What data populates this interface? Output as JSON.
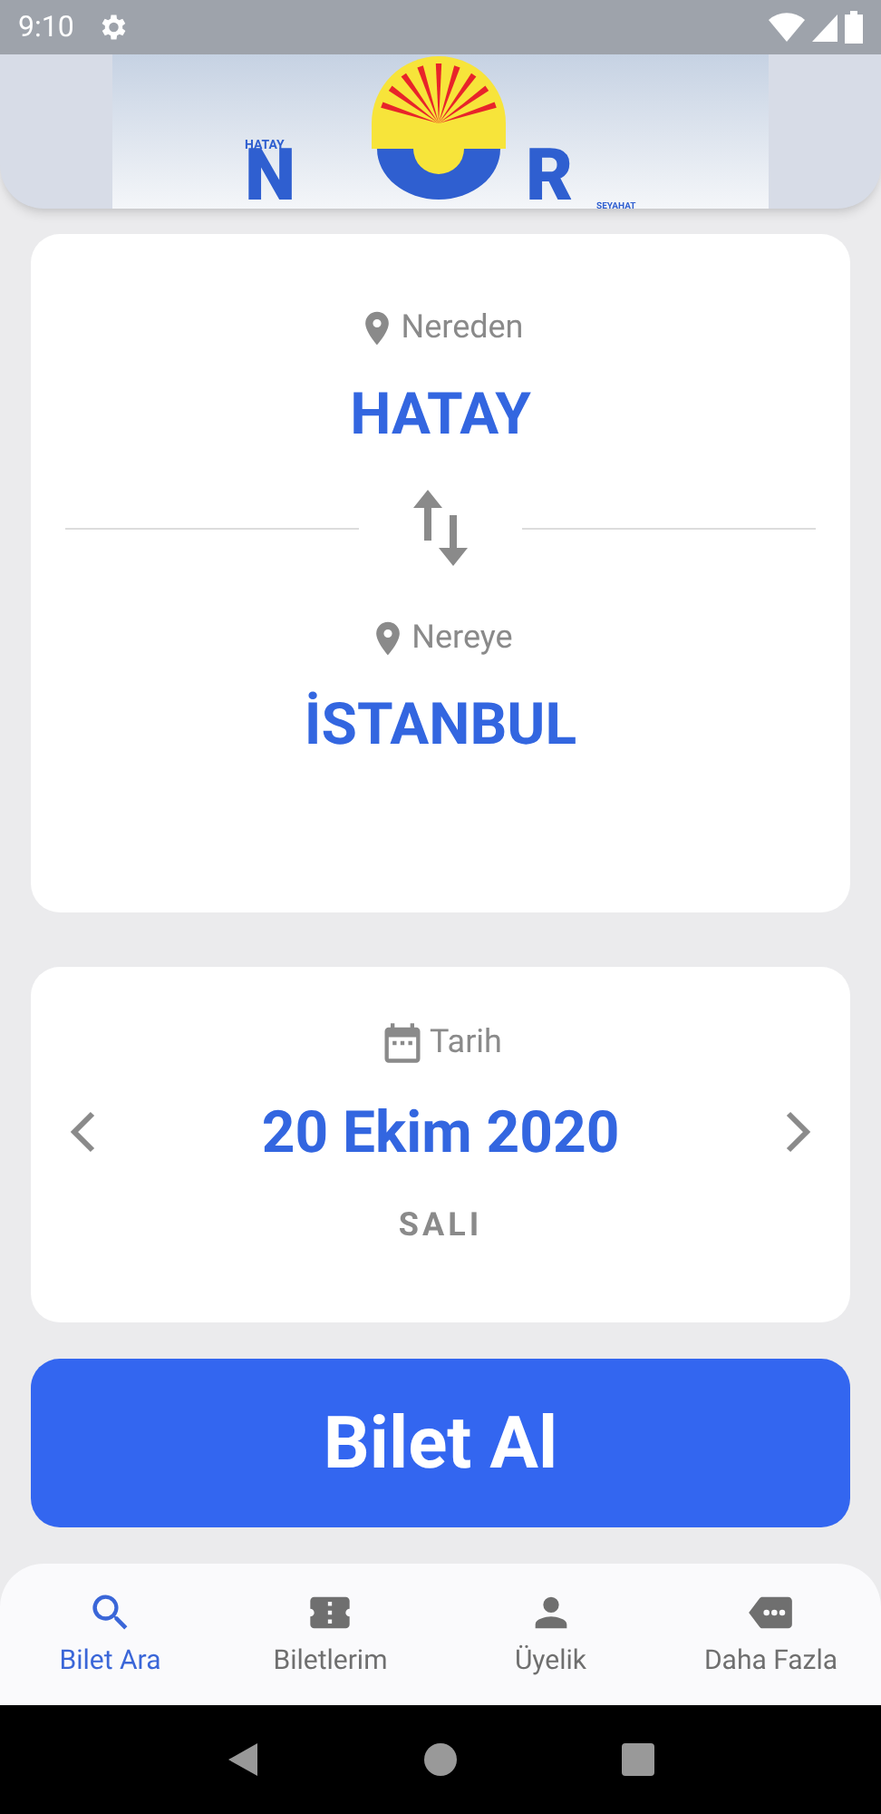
{
  "status_bar": {
    "time": "9:10"
  },
  "logo": {
    "top": "HATAY",
    "left": "N",
    "right": "R",
    "bottom": "SEYAHAT"
  },
  "route": {
    "from_label": "Nereden",
    "from": "HATAY",
    "to_label": "Nereye",
    "to": "İSTANBUL"
  },
  "date": {
    "label": "Tarih",
    "value": "20 Ekim 2020",
    "weekday": "SALI"
  },
  "buy_button": "Bilet Al",
  "tabs": [
    {
      "kind": "search",
      "label": "Bilet Ara",
      "selected": true
    },
    {
      "kind": "ticket",
      "label": "Biletlerim",
      "selected": false
    },
    {
      "kind": "person",
      "label": "Üyelik",
      "selected": false
    },
    {
      "kind": "more",
      "label": "Daha Fazla",
      "selected": false
    }
  ]
}
